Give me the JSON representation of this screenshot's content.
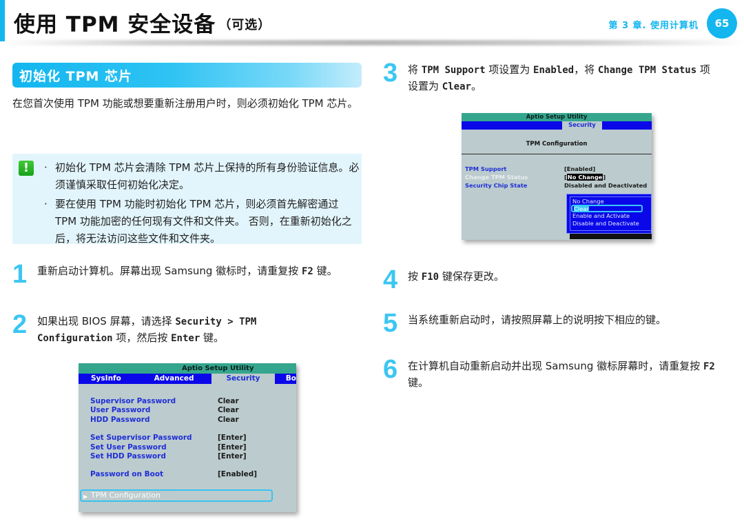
{
  "header": {
    "title": "使用 TPM 安全设备",
    "title_suffix": "（可选）",
    "chapter": "第 3 章. 使用计算机",
    "page_number": "65",
    "accent_color": "#13b6ef"
  },
  "section": {
    "title": "初始化 TPM 芯片",
    "intro": "在您首次使用 TPM 功能或想要重新注册用户时，则必须初始化 TPM 芯片。"
  },
  "note": {
    "icon": "exclamation-icon",
    "bullet": "·",
    "items": [
      "初始化 TPM 芯片会清除 TPM 芯片上保持的所有身份验证信息。必须谨慎采取任何初始化决定。",
      "要在使用 TPM 功能时初始化 TPM 芯片，则必须首先解密通过 TPM 功能加密的任何现有文件和文件夹。 否则，在重新初始化之后，将无法访问这些文件和文件夹。"
    ]
  },
  "steps": [
    {
      "num": "1",
      "parts": [
        "重新启动计算机。屏幕出现 Samsung 徽标时，请重复按 ",
        "F2",
        " 键。"
      ]
    },
    {
      "num": "2",
      "parts": [
        "如果出现 BIOS 屏幕，请选择 ",
        "Security > TPM Configuration",
        " 项，然后按 ",
        "Enter",
        " 键。"
      ]
    },
    {
      "num": "3",
      "parts": [
        "将 ",
        "TPM Support",
        " 项设置为 ",
        "Enabled",
        "，将 ",
        "Change TPM Status",
        " 项设置为 ",
        "Clear",
        "。"
      ]
    },
    {
      "num": "4",
      "parts": [
        "按 ",
        "F10",
        " 键保存更改。"
      ]
    },
    {
      "num": "5",
      "parts": [
        "当系统重新启动时，请按照屏幕上的说明按下相应的键。"
      ]
    },
    {
      "num": "6",
      "parts": [
        "在计算机自动重新启动并出现 Samsung 徽标屏幕时，请重复按 ",
        "F2",
        " 键。"
      ]
    }
  ],
  "bios_security": {
    "title": "Aptio Setup Utility",
    "tabs": [
      "SysInfo",
      "Advanced",
      "Security",
      "Bo"
    ],
    "active_tab": "Security",
    "rows": [
      {
        "label": "Supervisor Password",
        "value": "Clear"
      },
      {
        "label": "User Password",
        "value": "Clear"
      },
      {
        "label": "HDD Password",
        "value": "Clear"
      },
      {
        "label": "Set Supervisor Password",
        "value": "[Enter]"
      },
      {
        "label": "Set User Password",
        "value": "[Enter]"
      },
      {
        "label": "Set HDD Password",
        "value": "[Enter]"
      },
      {
        "label": "Password on Boot",
        "value": "[Enabled]"
      }
    ],
    "highlighted_item": "TPM Configuration"
  },
  "bios_tpm": {
    "title": "Aptio Setup Utility",
    "active_tab": "Security",
    "heading": "TPM Configuration",
    "rows": [
      {
        "label": "TPM Support",
        "value": "[Enabled]"
      },
      {
        "label": "Change TPM Status",
        "value_open": "[",
        "value": "No Change",
        "value_close": "]"
      },
      {
        "label": "Security Chip State",
        "value": "Disabled and Deactivated"
      }
    ],
    "options": [
      "No Change",
      "Clear",
      "Enable and Activate",
      "Disable and Deactivate"
    ],
    "selected_option": "Clear"
  }
}
